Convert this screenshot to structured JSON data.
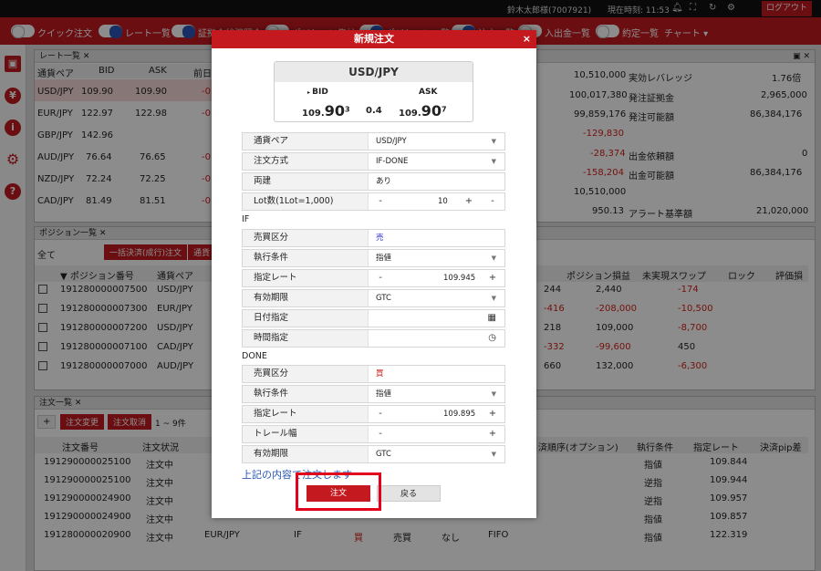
{
  "topbar": {
    "user": "鈴木太郎様(7007921)",
    "time": "現在時刻: 11:53",
    "logout": "ログアウト"
  },
  "tabs": [
    {
      "label": "クイック注文",
      "on": false
    },
    {
      "label": "レート一覧",
      "on": true
    },
    {
      "label": "証拠金状況照会",
      "on": true
    },
    {
      "label": "ポジション集計",
      "on": false
    },
    {
      "label": "ポジション一覧",
      "on": true
    },
    {
      "label": "注文一覧",
      "on": true
    },
    {
      "label": "入出金一覧",
      "on": false
    },
    {
      "label": "約定一覧",
      "on": false
    },
    {
      "label": "チャート ▾",
      "on": null
    }
  ],
  "rate_panel": {
    "title": "レート一覧",
    "headers": [
      "通貨ペア",
      "BID",
      "ASK",
      "前日"
    ],
    "rows": [
      {
        "pair": "USD/JPY",
        "bid": "109.90",
        "bid_sup": "1",
        "ask": "109.90",
        "ask_sup": "5",
        "chg": "-0."
      },
      {
        "pair": "EUR/JPY",
        "bid": "122.97",
        "bid_sup": "1",
        "ask": "122.98",
        "ask_sup": "0",
        "chg": "-0."
      },
      {
        "pair": "GBP/JPY",
        "bid": "142.96",
        "bid_sup": "0",
        "ask": "",
        "ask_sup": "",
        "chg": ""
      },
      {
        "pair": "AUD/JPY",
        "bid": "76.64",
        "bid_sup": "2",
        "ask": "76.65",
        "ask_sup": "1",
        "chg": "-0."
      },
      {
        "pair": "NZD/JPY",
        "bid": "72.24",
        "bid_sup": "2",
        "ask": "72.25",
        "ask_sup": "7",
        "chg": "-0."
      },
      {
        "pair": "CAD/JPY",
        "bid": "81.49",
        "bid_sup": "8",
        "ask": "81.51",
        "ask_sup": "5",
        "chg": "-0."
      }
    ]
  },
  "margin_panel": {
    "col1": [
      "10,510,000",
      "100,017,380",
      "99,859,176",
      "-129,830",
      "-28,374",
      "-158,204",
      "10,510,000",
      "950.13"
    ],
    "labels2": [
      "実効レバレッジ",
      "発注証拠金",
      "発注可能額",
      "",
      "出金依頼額",
      "出金可能額",
      "",
      "アラート基準額"
    ],
    "vals2": [
      "1.76倍",
      "2,965,000",
      "86,384,176",
      "",
      "0",
      "86,384,176",
      "",
      "21,020,000"
    ]
  },
  "position_panel": {
    "title": "ポジション一覧",
    "filter": "全て",
    "btn1": "一括決済(成行)注文",
    "btn2": "通貨",
    "headers": [
      "▼ ポジション番号",
      "通貨ペア",
      "ポジション損益",
      "未実現スワップ",
      "ロック",
      "評価損"
    ],
    "rows": [
      {
        "no": "191280000007500",
        "pair": "USD/JPY",
        "a": "244",
        "pl": "2,440",
        "swap": "-174"
      },
      {
        "no": "191280000007300",
        "pair": "EUR/JPY",
        "a": "-416",
        "pl": "-208,000",
        "swap": "-10,500"
      },
      {
        "no": "191280000007200",
        "pair": "USD/JPY",
        "a": "218",
        "pl": "109,000",
        "swap": "-8,700"
      },
      {
        "no": "191280000007100",
        "pair": "CAD/JPY",
        "a": "-332",
        "pl": "-99,600",
        "swap": "450"
      },
      {
        "no": "191280000007000",
        "pair": "AUD/JPY",
        "a": "660",
        "pl": "132,000",
        "swap": "-6,300"
      }
    ]
  },
  "order_panel": {
    "title": "注文一覧",
    "btn_change": "注文変更",
    "btn_cancel": "注文取消",
    "count": "1 ~ 9件",
    "headers": [
      "注文番号",
      "注文状況",
      "済順序(オプション)",
      "執行条件",
      "指定レート",
      "決済pip差"
    ],
    "rows": [
      {
        "no": "191290000025100",
        "status": "注文中",
        "cond": "指値",
        "rate": "109.844"
      },
      {
        "no": "191290000025100",
        "status": "注文中",
        "cond": "逆指",
        "rate": "109.944"
      },
      {
        "no": "191290000024900",
        "status": "注文中",
        "cond": "逆指",
        "rate": "109.957"
      },
      {
        "no": "191290000024900",
        "status": "注文中",
        "cond": "指値",
        "rate": "109.857"
      },
      {
        "no": "191280000020900",
        "status": "注文中",
        "pair": "EUR/JPY",
        "type": "IF",
        "side": "買",
        "kind": "売買",
        "lock": "なし",
        "fifo": "FIFO",
        "cond": "指値",
        "rate": "122.319"
      }
    ]
  },
  "modal": {
    "title": "新規注文",
    "close": "×",
    "price": {
      "pair": "USD/JPY",
      "bid_label": "BID",
      "ask_label": "ASK",
      "bid_main": "109.",
      "bid_big": "90",
      "bid_sup": "3",
      "spread": "0.4",
      "ask_main": "109.",
      "ask_big": "90",
      "ask_sup": "7"
    },
    "fields": [
      {
        "label": "通貨ペア",
        "value": "USD/JPY",
        "type": "select"
      },
      {
        "label": "注文方式",
        "value": "IF-DONE",
        "type": "select"
      },
      {
        "label": "両建",
        "value": "あり",
        "type": "text"
      },
      {
        "label": "Lot数(1Lot=1,000)",
        "value": "10",
        "type": "stepper"
      }
    ],
    "if_label": "IF",
    "if_fields": [
      {
        "label": "売買区分",
        "value": "売",
        "type": "side",
        "color": "#3a3ad8"
      },
      {
        "label": "執行条件",
        "value": "指値",
        "type": "select"
      },
      {
        "label": "指定レート",
        "value": "109.945",
        "type": "stepper"
      },
      {
        "label": "有効期限",
        "value": "GTC",
        "type": "select"
      },
      {
        "label": "日付指定",
        "value": "",
        "type": "date"
      },
      {
        "label": "時間指定",
        "value": "",
        "type": "time"
      }
    ],
    "done_label": "DONE",
    "done_fields": [
      {
        "label": "売買区分",
        "value": "買",
        "type": "side",
        "color": "#d2231a"
      },
      {
        "label": "執行条件",
        "value": "指値",
        "type": "select"
      },
      {
        "label": "指定レート",
        "value": "109.895",
        "type": "stepper"
      },
      {
        "label": "トレール幅",
        "value": "",
        "type": "stepper"
      },
      {
        "label": "有効期限",
        "value": "GTC",
        "type": "select"
      }
    ],
    "confirm_text": "上記の内容で注文します",
    "order_button": "注文",
    "back_button": "戻る"
  }
}
